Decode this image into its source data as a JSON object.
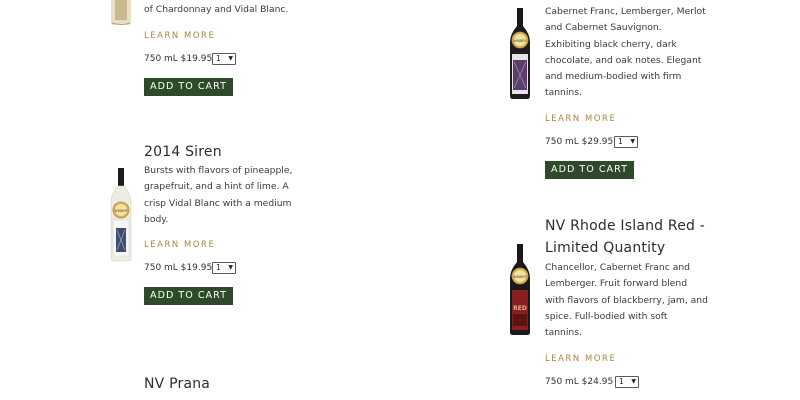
{
  "products": [
    {
      "desc_lines": [
        "of Chardonnay and Vidal Blanc."
      ],
      "learn_more": "LEARN MORE",
      "price": "750 mL $19.95",
      "qty": "1",
      "cart_label": "ADD TO CART"
    },
    {
      "title": "2014 Siren",
      "desc_lines": [
        "Bursts with flavors of pineapple,",
        "grapefruit, and a hint of lime. A",
        "crisp Vidal Blanc with a medium",
        "body."
      ],
      "learn_more": "LEARN MORE",
      "price": "750 mL $19.95",
      "qty": "1",
      "cart_label": "ADD TO CART",
      "badge": "WINNER"
    },
    {
      "title": "NV Prana"
    },
    {
      "desc_lines": [
        "Cabernet Franc, Lemberger, Merlot",
        "and Cabernet Sauvignon.",
        "Exhibiting black cherry, dark",
        "chocolate, and oak notes. Elegant",
        "and medium-bodied with firm",
        "tannins."
      ],
      "learn_more": "LEARN MORE",
      "price": "750 mL $29.95",
      "qty": "1",
      "cart_label": "ADD TO CART",
      "badge": "WINNER"
    },
    {
      "title_lines": [
        "NV Rhode Island Red -",
        "Limited Quantity"
      ],
      "desc_lines": [
        "Chancellor, Cabernet Franc and",
        "Lemberger. Fruit forward blend",
        "with flavors of blackberry, jam, and",
        "spice. Full-bodied with soft",
        "tannins."
      ],
      "learn_more": "LEARN MORE",
      "price": "750 mL $24.95",
      "qty": "1",
      "badge": "WINNER",
      "label_text": "RED"
    }
  ],
  "colors": {
    "cart_bg": "#2e4a2a",
    "learn_more": "#a9873e"
  }
}
